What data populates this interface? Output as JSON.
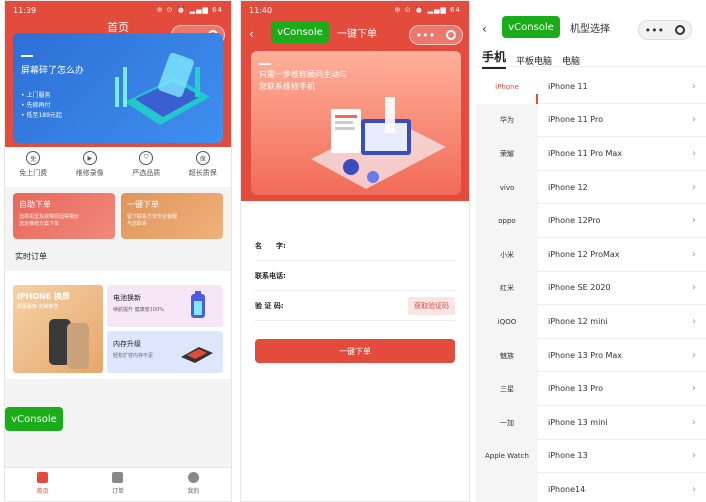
{
  "phone1": {
    "status_time": "11:39",
    "status_icons": "⊕ ⊙ ⏰ ▂▄▆ 64",
    "title": "首页",
    "banner": {
      "headline": "屏幕碎了怎么办",
      "bullets": [
        "• 上门服务",
        "• 先修再付",
        "• 低至189元起"
      ]
    },
    "services": [
      {
        "icon": "免",
        "label": "免上门费"
      },
      {
        "icon": "▶",
        "label": "维修录像"
      },
      {
        "icon": "⛉",
        "label": "严选品质"
      },
      {
        "icon": "保",
        "label": "超长质保"
      }
    ],
    "cards": [
      {
        "title": "自助下单",
        "sub": "选择机型及故障原因得报价\n选定维修方案下单",
        "color": "#e9675a"
      },
      {
        "title": "一键下单",
        "sub": "留下联系方式专业客服\n与您联系",
        "color": "#e0945a"
      }
    ],
    "realtime_orders": "实时订单",
    "promo_big": {
      "title": "iPHONE 换屏",
      "sub": "屏幕更换 完美新生"
    },
    "promo_small": [
      {
        "title": "电池换新",
        "sub": "续航提升 健康度100%"
      },
      {
        "title": "内存升级",
        "sub": "轻松扩容内存不足"
      }
    ],
    "vconsole": "vConsole",
    "tabs": [
      {
        "label": "首页",
        "active": true
      },
      {
        "label": "订单",
        "active": false
      },
      {
        "label": "我的",
        "active": false
      }
    ]
  },
  "phone2": {
    "status_time": "11:40",
    "status_icons": "⊕ ⊙ ⏰ ▂▄▆ 64",
    "vconsole": "vConsole",
    "title": "一键下单",
    "banner": {
      "headline": "只需一步维修顾问主动与\n您联系维修手机"
    },
    "form": {
      "name_label": "名　　字:",
      "phone_label": "联系电话:",
      "code_label": "验  证  码:",
      "code_button": "获取验证码"
    },
    "submit": "一键下单"
  },
  "phone3": {
    "vconsole": "vConsole",
    "title": "机型选择",
    "tabs": [
      {
        "label": "手机",
        "active": true
      },
      {
        "label": "平板电脑",
        "active": false
      },
      {
        "label": "电脑",
        "active": false
      }
    ],
    "brands": [
      "iPhone",
      "华为",
      "荣耀",
      "vivo",
      "oppo",
      "小米",
      "红米",
      "iQOO",
      "魅族",
      "三星",
      "一加",
      "Apple Watch"
    ],
    "selected_brand": "iPhone",
    "models": [
      "iPhone 11",
      "iPhone 11 Pro",
      "iPhone 11 Pro Max",
      "iPhone 12",
      "iPhone 12Pro",
      "iPhone 12 ProMax",
      "iPhone SE 2020",
      "iPhone 12 mini",
      "iPhone 13 Pro Max",
      "iPhone 13 Pro",
      "iPhone 13 mini",
      "iPhone 13",
      "iPhone14"
    ]
  },
  "colors": {
    "primary": "#e34b3d",
    "vconsole": "#1aad19"
  }
}
